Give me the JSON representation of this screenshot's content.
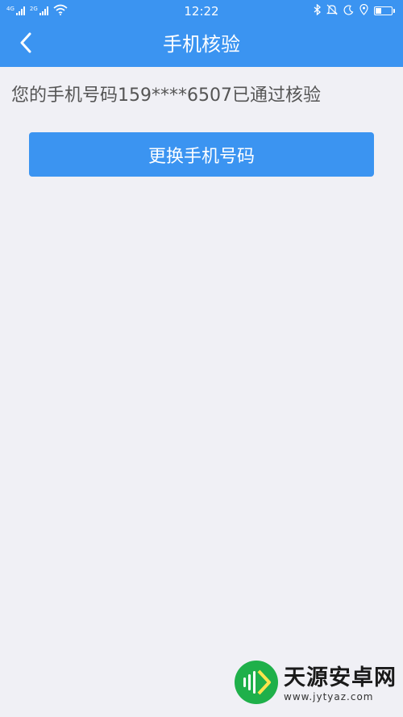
{
  "status_bar": {
    "sim1_label": "4G",
    "sim2_label": "2G",
    "time": "12:22",
    "battery_level": 0.45,
    "icons": [
      "signal-icon",
      "wifi-icon",
      "bluetooth-icon",
      "silent-icon",
      "moon-icon",
      "location-icon",
      "battery-icon"
    ]
  },
  "nav": {
    "title": "手机核验",
    "back_icon": "back-icon"
  },
  "main": {
    "verify_message": "您的手机号码159****6507已通过核验",
    "change_button_label": "更换手机号码"
  },
  "watermark": {
    "title": "天源安卓网",
    "url": "www.jytyaz.com"
  },
  "colors": {
    "accent": "#3b94f1",
    "background": "#f0f0f5",
    "text": "#555555"
  }
}
